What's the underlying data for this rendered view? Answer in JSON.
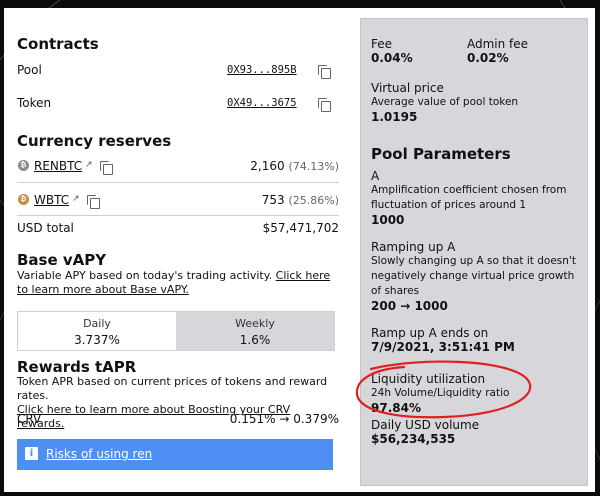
{
  "contracts": {
    "title": "Contracts",
    "pool_label": "Pool",
    "pool_addr": "0X93...895B",
    "token_label": "Token",
    "token_addr": "0X49...3675"
  },
  "reserves": {
    "title": "Currency reserves",
    "coins": [
      {
        "name": "RENBTC",
        "amount": "2,160",
        "pct": "(74.13%)",
        "color": "#8c8c8c",
        "icon": "renbtc-icon"
      },
      {
        "name": "WBTC",
        "amount": "753",
        "pct": "(25.86%)",
        "color": "#c98d3c",
        "icon": "wbtc-icon"
      }
    ],
    "usd_label": "USD total",
    "usd_value": "$57,471,702"
  },
  "base_vapy": {
    "title": "Base vAPY",
    "desc_plain": "Variable APY based on today's trading activity. ",
    "desc_link": "Click here to learn more about Base vAPY.",
    "daily_label": "Daily",
    "daily_value": "3.737%",
    "weekly_label": "Weekly",
    "weekly_value": "1.6%"
  },
  "rewards": {
    "title": "Rewards tAPR",
    "desc_plain": "Token APR based on current prices of tokens and reward rates.",
    "desc_link": "Click here to learn more about Boosting your CRV rewards.",
    "crv_label": "CRV",
    "crv_value": "0.151% → 0.379%"
  },
  "risk": {
    "label": "Risks of using ren"
  },
  "stats": {
    "fee_label": "Fee",
    "fee_value": "0.04%",
    "admin_fee_label": "Admin fee",
    "admin_fee_value": "0.02%",
    "virtual_price_label": "Virtual price",
    "virtual_price_desc": "Average value of pool token",
    "virtual_price_value": "1.0195"
  },
  "params": {
    "title": "Pool Parameters",
    "a_label": "A",
    "a_desc": "Amplification coefficient chosen from fluctuation of prices around 1",
    "a_value": "1000",
    "ramping_label": "Ramping up A",
    "ramping_desc": "Slowly changing up A so that it doesn't negatively change virtual price growth of shares",
    "ramping_value": "200 → 1000",
    "ramp_end_label": "Ramp up A ends on",
    "ramp_end_value": "7/9/2021, 3:51:41 PM",
    "liq_label": "Liquidity utilization",
    "liq_desc": "24h Volume/Liquidity ratio",
    "liq_value": "97.84%",
    "daily_usd_label": "Daily USD volume",
    "daily_usd_value": "$56,234,535"
  },
  "colors": {
    "highlight_circle": "#e02020",
    "banner": "#4d8ff2",
    "panel": "#d7d7db"
  }
}
